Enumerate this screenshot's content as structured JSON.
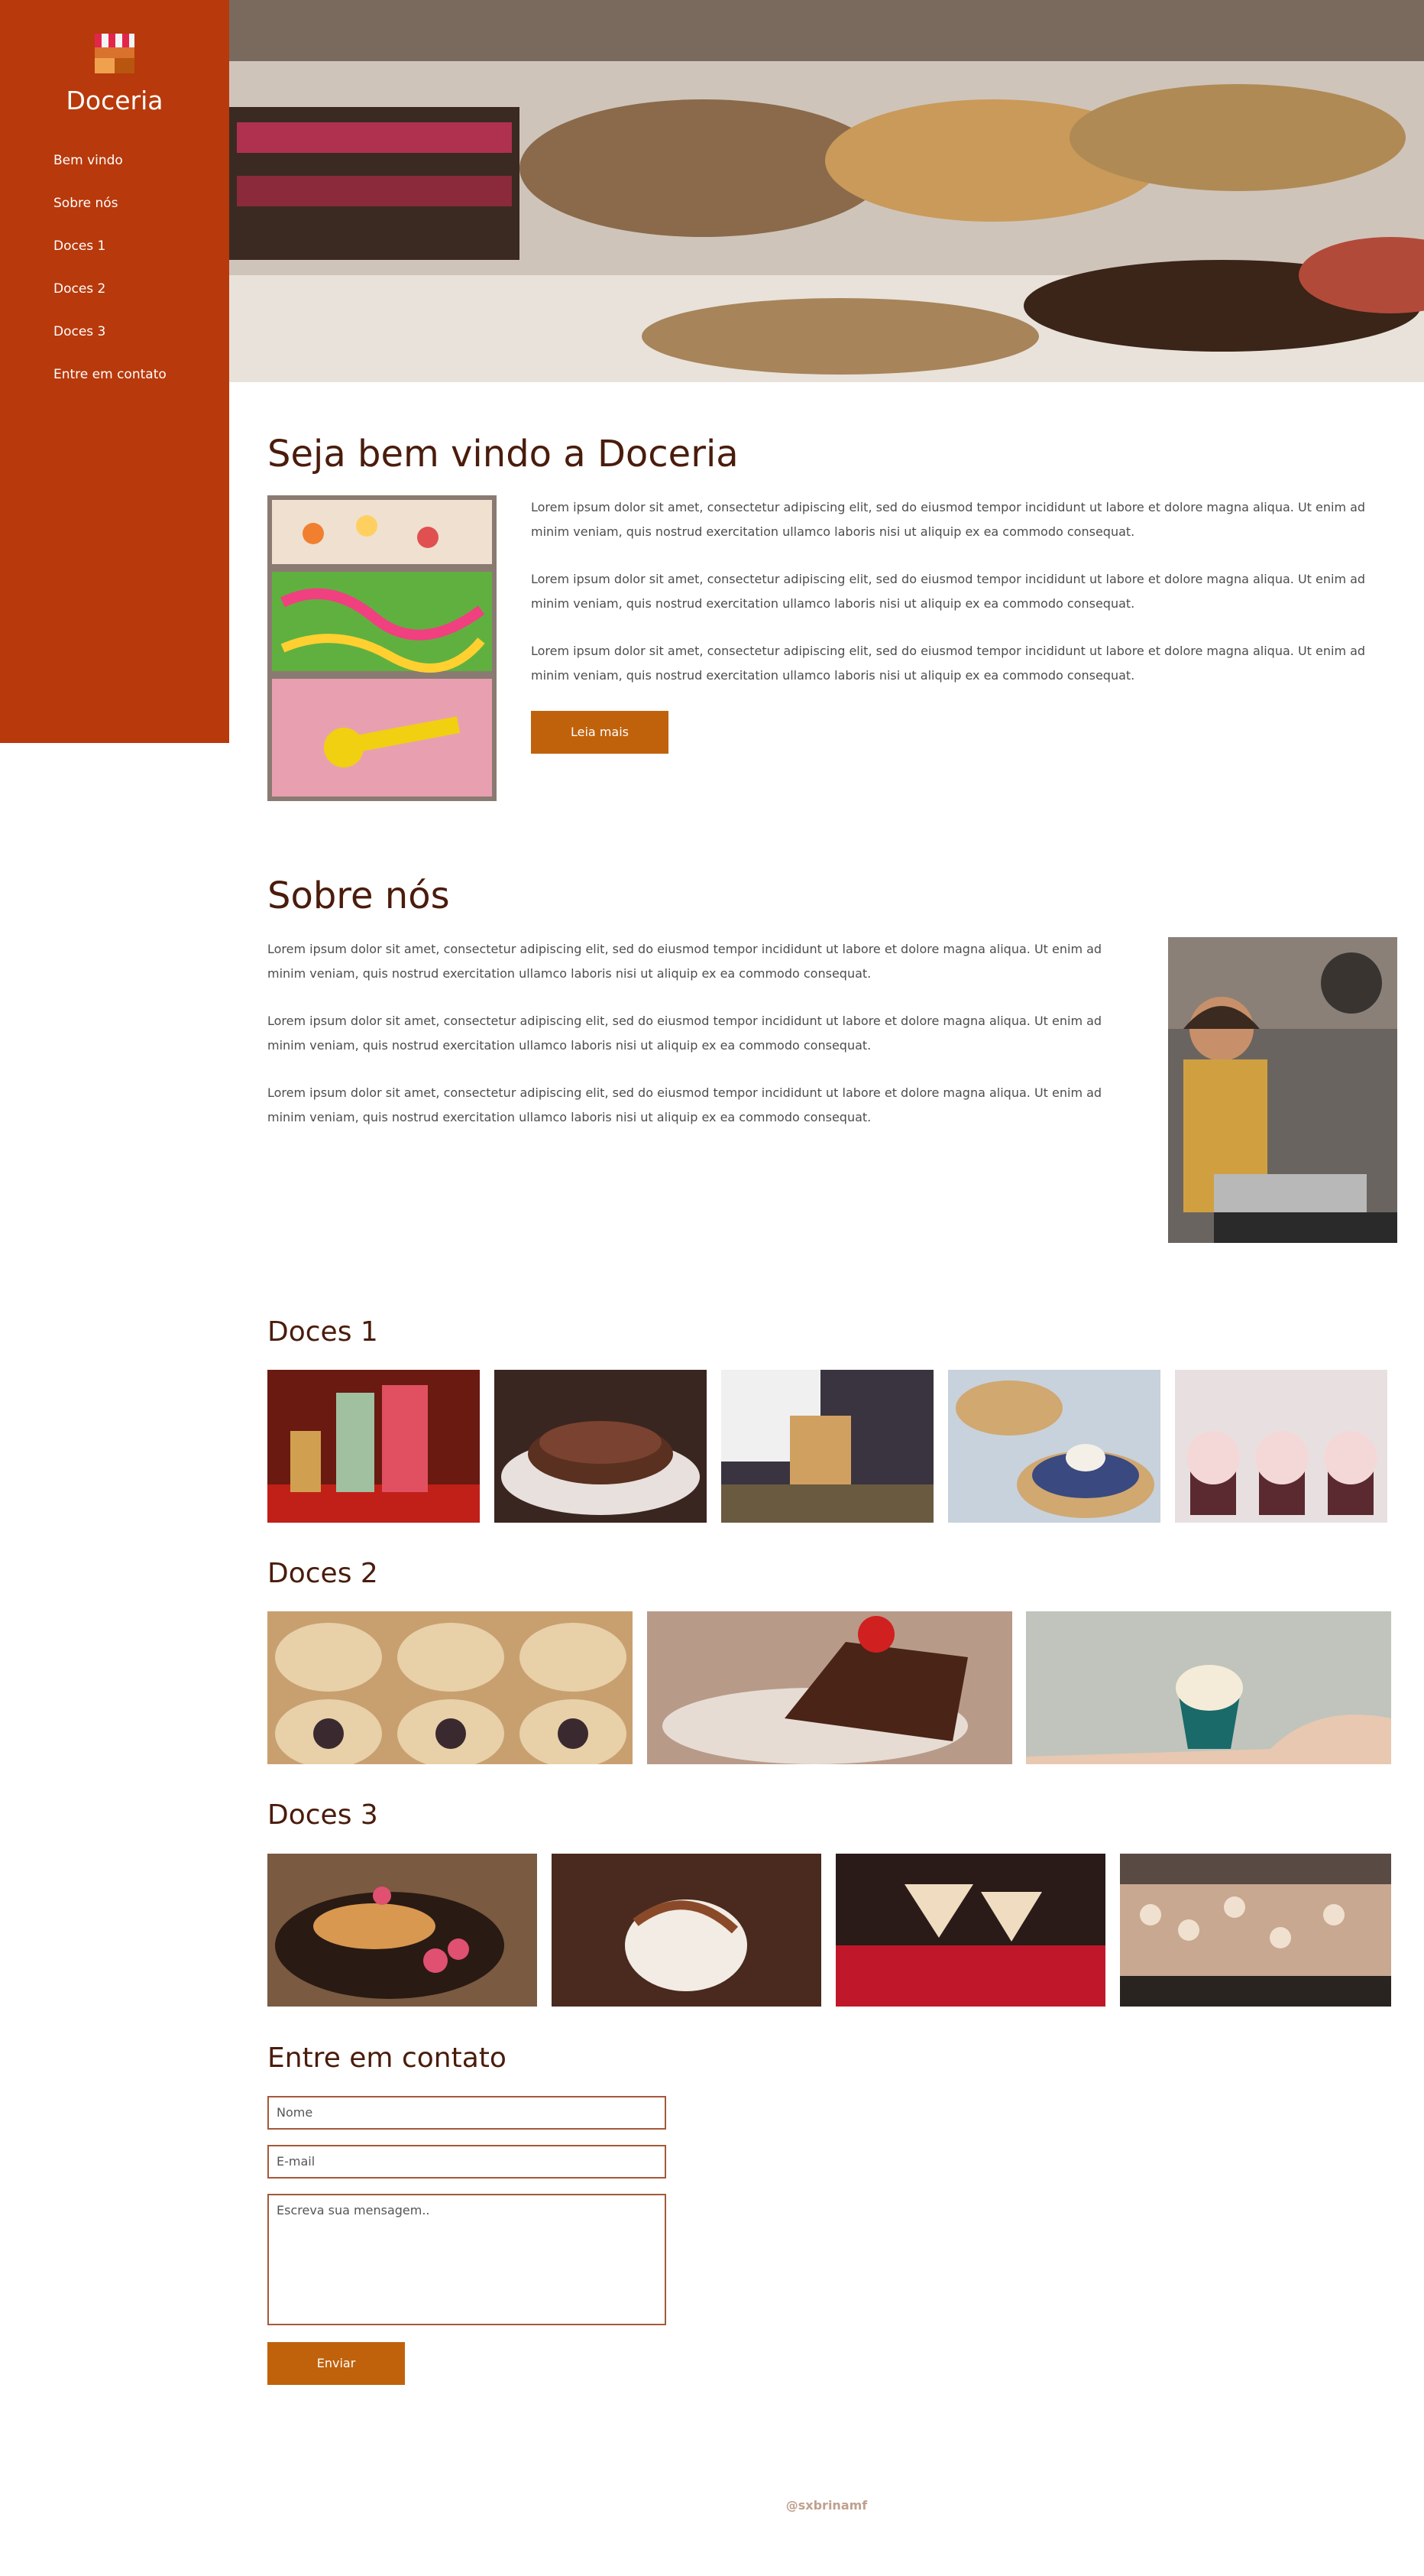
{
  "brand": {
    "name": "Doceria"
  },
  "nav": {
    "items": [
      "Bem vindo",
      "Sobre nós",
      "Doces 1",
      "Doces 2",
      "Doces 3",
      "Entre em contato"
    ]
  },
  "welcome": {
    "title": "Seja bem vindo a Doceria",
    "paragraphs": [
      "Lorem ipsum dolor sit amet, consectetur adipiscing elit, sed do eiusmod tempor incididunt ut labore et dolore magna aliqua. Ut enim ad minim veniam, quis nostrud exercitation ullamco laboris nisi ut aliquip ex ea commodo consequat.",
      "Lorem ipsum dolor sit amet, consectetur adipiscing elit, sed do eiusmod tempor incididunt ut labore et dolore magna aliqua. Ut enim ad minim veniam, quis nostrud exercitation ullamco laboris nisi ut aliquip ex ea commodo consequat.",
      "Lorem ipsum dolor sit amet, consectetur adipiscing elit, sed do eiusmod tempor incididunt ut labore et dolore magna aliqua. Ut enim ad minim veniam, quis nostrud exercitation ullamco laboris nisi ut aliquip ex ea commodo consequat."
    ],
    "button": "Leia mais"
  },
  "about": {
    "title": "Sobre nós",
    "paragraphs": [
      "Lorem ipsum dolor sit amet, consectetur adipiscing elit, sed do eiusmod tempor incididunt ut labore et dolore magna aliqua. Ut enim ad minim veniam, quis nostrud exercitation ullamco laboris nisi ut aliquip ex ea commodo consequat.",
      "Lorem ipsum dolor sit amet, consectetur adipiscing elit, sed do eiusmod tempor incididunt ut labore et dolore magna aliqua. Ut enim ad minim veniam, quis nostrud exercitation ullamco laboris nisi ut aliquip ex ea commodo consequat.",
      "Lorem ipsum dolor sit amet, consectetur adipiscing elit, sed do eiusmod tempor incididunt ut labore et dolore magna aliqua. Ut enim ad minim veniam, quis nostrud exercitation ullamco laboris nisi ut aliquip ex ea commodo consequat."
    ]
  },
  "gallery1": {
    "title": "Doces 1"
  },
  "gallery2": {
    "title": "Doces 2"
  },
  "gallery3": {
    "title": "Doces 3"
  },
  "contact": {
    "title": "Entre em contato",
    "name_placeholder": "Nome",
    "email_placeholder": "E-mail",
    "message_placeholder": "Escreva sua mensagem..",
    "button": "Enviar"
  },
  "footer": {
    "credit": "@sxbrinamf"
  },
  "colors": {
    "sidebar": "#b8390b",
    "accent": "#c0620c",
    "heading": "#4a1c0c"
  }
}
